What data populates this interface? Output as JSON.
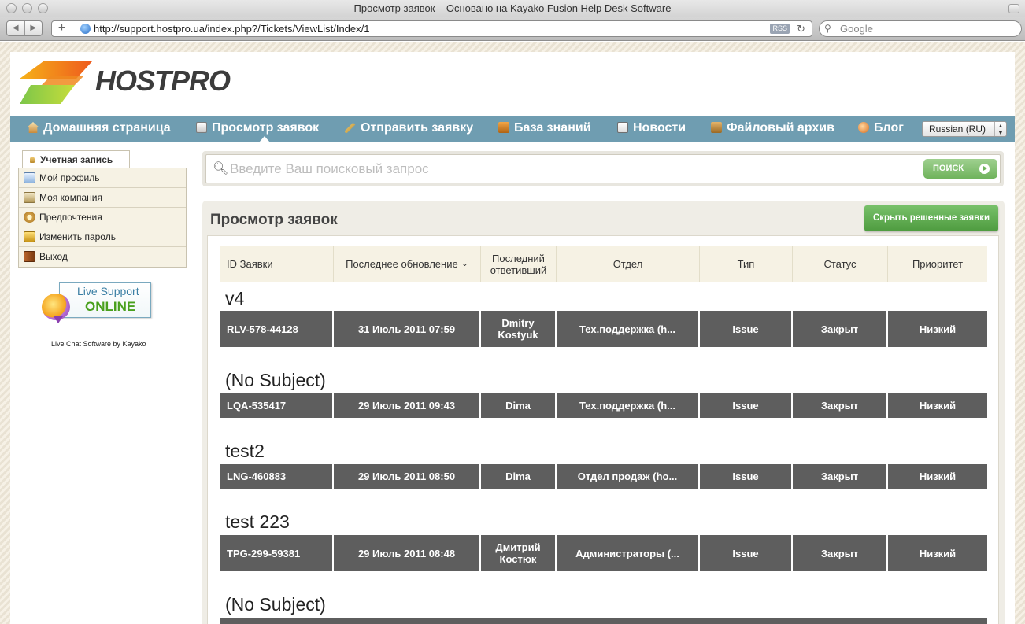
{
  "browser": {
    "window_title": "Просмотр заявок – Основано на Kayako Fusion Help Desk Software",
    "url": "http://support.hostpro.ua/index.php?/Tickets/ViewList/Index/1",
    "rss_label": "RSS",
    "search_engine_placeholder": "Google"
  },
  "header": {
    "logo_text": "HOSTPRO"
  },
  "nav": {
    "items": [
      {
        "label": "Домашняя страница",
        "icon": "home-icon"
      },
      {
        "label": "Просмотр заявок",
        "icon": "document-icon"
      },
      {
        "label": "Отправить заявку",
        "icon": "pencil-icon"
      },
      {
        "label": "База знаний",
        "icon": "book-icon"
      },
      {
        "label": "Новости",
        "icon": "news-icon"
      },
      {
        "label": "Файловый архив",
        "icon": "box-icon"
      },
      {
        "label": "Блог",
        "icon": "blog-icon"
      }
    ],
    "language": "Russian (RU)"
  },
  "sidebar": {
    "tab_label": "Учетная запись",
    "items": [
      {
        "label": "Мой профиль"
      },
      {
        "label": "Моя компания"
      },
      {
        "label": "Предпочтения"
      },
      {
        "label": "Изменить пароль"
      },
      {
        "label": "Выход"
      }
    ],
    "live_support_line1": "Live Support",
    "live_support_line2": "ONLINE",
    "live_chat_credit": "Live Chat Software by Kayako"
  },
  "search": {
    "placeholder": "Введите Ваш поисковый запрос",
    "button_label": "ПОИСК"
  },
  "tickets": {
    "title": "Просмотр заявок",
    "hide_resolved_label": "Скрыть решенные заявки",
    "columns": [
      "ID Заявки",
      "Последнее обновление",
      "Последний ответивший",
      "Отдел",
      "Тип",
      "Статус",
      "Приоритет"
    ],
    "sort_indicator": "⌄",
    "rows": [
      {
        "subject": "v4",
        "id": "RLV-578-44128",
        "updated": "31 Июль 2011 07:59",
        "replier": "Dmitry Kostyuk",
        "department": "Тех.поддержка (h...",
        "type": "Issue",
        "status": "Закрыт",
        "priority": "Низкий"
      },
      {
        "subject": "(No Subject)",
        "id": "LQA-535417",
        "updated": "29 Июль 2011 09:43",
        "replier": "Dima",
        "department": "Тех.поддержка (h...",
        "type": "Issue",
        "status": "Закрыт",
        "priority": "Низкий"
      },
      {
        "subject": "test2",
        "id": "LNG-460883",
        "updated": "29 Июль 2011 08:50",
        "replier": "Dima",
        "department": "Отдел продаж (ho...",
        "type": "Issue",
        "status": "Закрыт",
        "priority": "Низкий"
      },
      {
        "subject": "test 223",
        "id": "TPG-299-59381",
        "updated": "29 Июль 2011 08:48",
        "replier": "Дмитрий Костюк",
        "department": "Администраторы (...",
        "type": "Issue",
        "status": "Закрыт",
        "priority": "Низкий"
      },
      {
        "subject": "(No Subject)"
      }
    ]
  }
}
